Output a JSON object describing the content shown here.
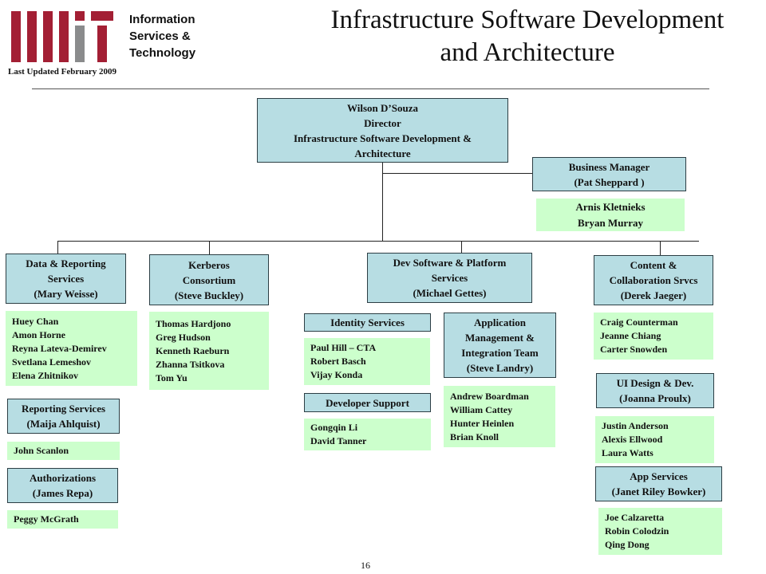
{
  "header": {
    "dept_name": "Information\nServices &\nTechnology",
    "last_updated": "Last Updated February 2009",
    "title": "Infrastructure Software Development\nand Architecture",
    "colors": {
      "logo_red": "#a31f34",
      "logo_gray": "#8a8b8c",
      "box_blue": "#b7dde3",
      "box_green": "#ccffcc"
    }
  },
  "director": {
    "name": "Wilson D’Souza",
    "role": "Director",
    "unit": "Infrastructure Software Development &",
    "unit2": "Architecture"
  },
  "business_manager": {
    "line1": "Business Manager",
    "line2": "(Pat Sheppard )",
    "staff": [
      "Arnis Kletnieks",
      "Bryan Murray"
    ]
  },
  "data_reporting": {
    "line1": "Data & Reporting",
    "line2": "Services",
    "line3": "(Mary Weisse)",
    "staff": [
      "Huey Chan",
      "Amon Horne",
      "Reyna Lateva-Demirev",
      "Svetlana Lemeshov",
      "Elena Zhitnikov"
    ],
    "reporting": {
      "line1": "Reporting Services",
      "line2": "(Maija Ahlquist)",
      "staff": [
        "John Scanlon"
      ]
    },
    "authorizations": {
      "line1": "Authorizations",
      "line2": "(James Repa)",
      "staff": [
        "Peggy McGrath"
      ]
    }
  },
  "kerberos": {
    "line1": "Kerberos",
    "line2": "Consortium",
    "line3": "(Steve Buckley)",
    "staff": [
      "Thomas Hardjono",
      "Greg Hudson",
      "Kenneth Raeburn",
      "Zhanna Tsitkova",
      "Tom Yu"
    ]
  },
  "dev_software": {
    "line1": "Dev Software & Platform",
    "line2": "Services",
    "line3": "(Michael Gettes)",
    "identity": {
      "label": "Identity Services",
      "staff": [
        "Paul Hill – CTA",
        "Robert Basch",
        "Vijay Konda"
      ]
    },
    "developer": {
      "label": "Developer Support",
      "staff": [
        "Gongqin Li",
        "David Tanner"
      ]
    },
    "appint": {
      "line1": "Application",
      "line2": "Management &",
      "line3": "Integration Team",
      "line4": "(Steve Landry)",
      "staff": [
        "Andrew Boardman",
        "William Cattey",
        "Hunter Heinlen",
        "Brian Knoll"
      ]
    }
  },
  "content": {
    "line1": "Content &",
    "line2": "Collaboration Srvcs",
    "line3": "(Derek Jaeger)",
    "staff": [
      "Craig Counterman",
      "Jeanne Chiang",
      "Carter Snowden"
    ],
    "ui": {
      "line1": "UI Design & Dev.",
      "line2": "(Joanna Proulx)",
      "staff": [
        "Justin Anderson",
        "Alexis Ellwood",
        "Laura Watts"
      ]
    },
    "app": {
      "line1": "App Services",
      "line2": "(Janet Riley Bowker)",
      "staff": [
        "Joe Calzaretta",
        "Robin Colodzin",
        "Qing Dong"
      ]
    }
  },
  "page_number": "16"
}
